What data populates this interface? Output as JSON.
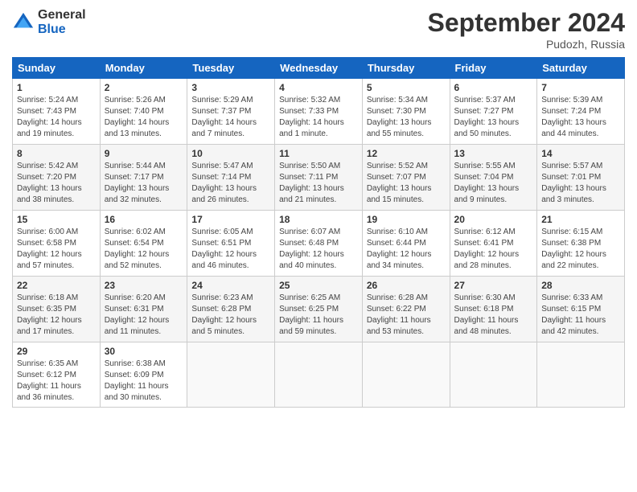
{
  "header": {
    "logo_general": "General",
    "logo_blue": "Blue",
    "month_title": "September 2024",
    "location": "Pudozh, Russia"
  },
  "calendar": {
    "headers": [
      "Sunday",
      "Monday",
      "Tuesday",
      "Wednesday",
      "Thursday",
      "Friday",
      "Saturday"
    ],
    "weeks": [
      [
        {
          "day": "1",
          "info": "Sunrise: 5:24 AM\nSunset: 7:43 PM\nDaylight: 14 hours\nand 19 minutes."
        },
        {
          "day": "2",
          "info": "Sunrise: 5:26 AM\nSunset: 7:40 PM\nDaylight: 14 hours\nand 13 minutes."
        },
        {
          "day": "3",
          "info": "Sunrise: 5:29 AM\nSunset: 7:37 PM\nDaylight: 14 hours\nand 7 minutes."
        },
        {
          "day": "4",
          "info": "Sunrise: 5:32 AM\nSunset: 7:33 PM\nDaylight: 14 hours\nand 1 minute."
        },
        {
          "day": "5",
          "info": "Sunrise: 5:34 AM\nSunset: 7:30 PM\nDaylight: 13 hours\nand 55 minutes."
        },
        {
          "day": "6",
          "info": "Sunrise: 5:37 AM\nSunset: 7:27 PM\nDaylight: 13 hours\nand 50 minutes."
        },
        {
          "day": "7",
          "info": "Sunrise: 5:39 AM\nSunset: 7:24 PM\nDaylight: 13 hours\nand 44 minutes."
        }
      ],
      [
        {
          "day": "8",
          "info": "Sunrise: 5:42 AM\nSunset: 7:20 PM\nDaylight: 13 hours\nand 38 minutes."
        },
        {
          "day": "9",
          "info": "Sunrise: 5:44 AM\nSunset: 7:17 PM\nDaylight: 13 hours\nand 32 minutes."
        },
        {
          "day": "10",
          "info": "Sunrise: 5:47 AM\nSunset: 7:14 PM\nDaylight: 13 hours\nand 26 minutes."
        },
        {
          "day": "11",
          "info": "Sunrise: 5:50 AM\nSunset: 7:11 PM\nDaylight: 13 hours\nand 21 minutes."
        },
        {
          "day": "12",
          "info": "Sunrise: 5:52 AM\nSunset: 7:07 PM\nDaylight: 13 hours\nand 15 minutes."
        },
        {
          "day": "13",
          "info": "Sunrise: 5:55 AM\nSunset: 7:04 PM\nDaylight: 13 hours\nand 9 minutes."
        },
        {
          "day": "14",
          "info": "Sunrise: 5:57 AM\nSunset: 7:01 PM\nDaylight: 13 hours\nand 3 minutes."
        }
      ],
      [
        {
          "day": "15",
          "info": "Sunrise: 6:00 AM\nSunset: 6:58 PM\nDaylight: 12 hours\nand 57 minutes."
        },
        {
          "day": "16",
          "info": "Sunrise: 6:02 AM\nSunset: 6:54 PM\nDaylight: 12 hours\nand 52 minutes."
        },
        {
          "day": "17",
          "info": "Sunrise: 6:05 AM\nSunset: 6:51 PM\nDaylight: 12 hours\nand 46 minutes."
        },
        {
          "day": "18",
          "info": "Sunrise: 6:07 AM\nSunset: 6:48 PM\nDaylight: 12 hours\nand 40 minutes."
        },
        {
          "day": "19",
          "info": "Sunrise: 6:10 AM\nSunset: 6:44 PM\nDaylight: 12 hours\nand 34 minutes."
        },
        {
          "day": "20",
          "info": "Sunrise: 6:12 AM\nSunset: 6:41 PM\nDaylight: 12 hours\nand 28 minutes."
        },
        {
          "day": "21",
          "info": "Sunrise: 6:15 AM\nSunset: 6:38 PM\nDaylight: 12 hours\nand 22 minutes."
        }
      ],
      [
        {
          "day": "22",
          "info": "Sunrise: 6:18 AM\nSunset: 6:35 PM\nDaylight: 12 hours\nand 17 minutes."
        },
        {
          "day": "23",
          "info": "Sunrise: 6:20 AM\nSunset: 6:31 PM\nDaylight: 12 hours\nand 11 minutes."
        },
        {
          "day": "24",
          "info": "Sunrise: 6:23 AM\nSunset: 6:28 PM\nDaylight: 12 hours\nand 5 minutes."
        },
        {
          "day": "25",
          "info": "Sunrise: 6:25 AM\nSunset: 6:25 PM\nDaylight: 11 hours\nand 59 minutes."
        },
        {
          "day": "26",
          "info": "Sunrise: 6:28 AM\nSunset: 6:22 PM\nDaylight: 11 hours\nand 53 minutes."
        },
        {
          "day": "27",
          "info": "Sunrise: 6:30 AM\nSunset: 6:18 PM\nDaylight: 11 hours\nand 48 minutes."
        },
        {
          "day": "28",
          "info": "Sunrise: 6:33 AM\nSunset: 6:15 PM\nDaylight: 11 hours\nand 42 minutes."
        }
      ],
      [
        {
          "day": "29",
          "info": "Sunrise: 6:35 AM\nSunset: 6:12 PM\nDaylight: 11 hours\nand 36 minutes."
        },
        {
          "day": "30",
          "info": "Sunrise: 6:38 AM\nSunset: 6:09 PM\nDaylight: 11 hours\nand 30 minutes."
        },
        {
          "day": "",
          "info": ""
        },
        {
          "day": "",
          "info": ""
        },
        {
          "day": "",
          "info": ""
        },
        {
          "day": "",
          "info": ""
        },
        {
          "day": "",
          "info": ""
        }
      ]
    ]
  }
}
